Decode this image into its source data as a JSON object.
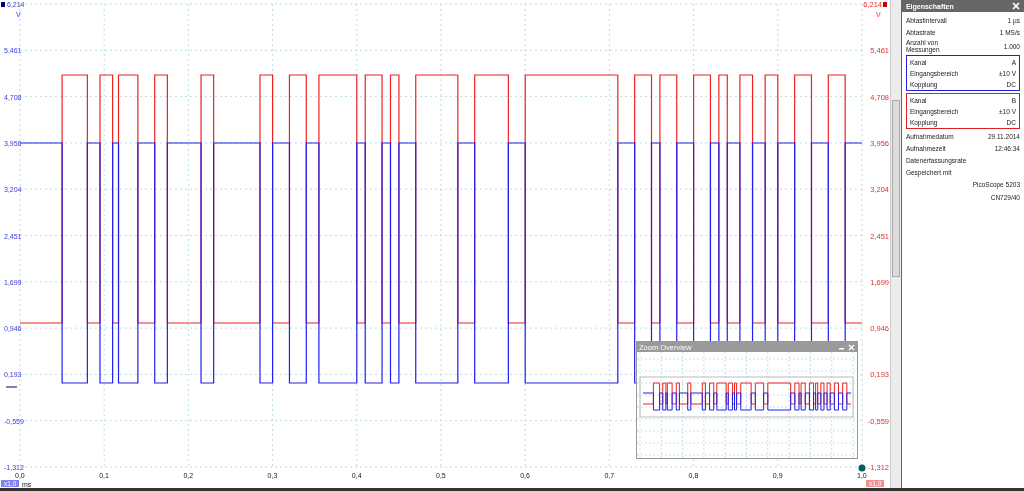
{
  "chart_window": {
    "left_axis": {
      "unit": "V",
      "ticks": [
        "6,214",
        "5,461",
        "4,708",
        "3,956",
        "3,204",
        "2,451",
        "1,699",
        "0,946",
        "0,193",
        "-0,559",
        "-1,312"
      ]
    },
    "right_axis": {
      "unit": "V",
      "ticks": [
        "6,214",
        "5,461",
        "4,708",
        "3,956",
        "3,204",
        "2,451",
        "1,699",
        "0,946",
        "0,193",
        "-0,559",
        "-1,312"
      ]
    },
    "x_axis": {
      "unit": "ms",
      "ticks": [
        "0,0",
        "0,1",
        "0,2",
        "0,3",
        "0,4",
        "0,5",
        "0,6",
        "0,7",
        "0,8",
        "0,9",
        "1,0"
      ]
    },
    "channel_a_badge": "x1,0",
    "channel_b_badge": "x1,0"
  },
  "zoom_overview": {
    "title": "Zoom Overview"
  },
  "properties": {
    "title": "Eigenschaften",
    "rows": [
      {
        "label": "Abtastintervall",
        "value": "1 µs"
      },
      {
        "label": "Abtastrate",
        "value": "1 MS/s"
      },
      {
        "label": "Anzahl von Messungen",
        "value": "1.000"
      }
    ],
    "channels": [
      {
        "color": "#2020e0",
        "rows": [
          {
            "label": "Kanal",
            "value": "A"
          },
          {
            "label": "Eingangsbereich",
            "value": "±10 V"
          },
          {
            "label": "Kopplung",
            "value": "DC"
          }
        ]
      },
      {
        "color": "#e02020",
        "rows": [
          {
            "label": "Kanal",
            "value": "B"
          },
          {
            "label": "Eingangsbereich",
            "value": "±10 V"
          },
          {
            "label": "Kopplung",
            "value": "DC"
          }
        ]
      }
    ],
    "details": [
      {
        "label": "Aufnahmedatum",
        "value": "29.11.2014"
      },
      {
        "label": "Aufnahmezeit",
        "value": "12:46:34"
      },
      {
        "label": "Datenerfassungsrate"
      },
      {
        "label": "Gespeichert mit"
      }
    ],
    "saved_with": [
      "PicoScope 5203",
      "CN729/40"
    ]
  }
}
